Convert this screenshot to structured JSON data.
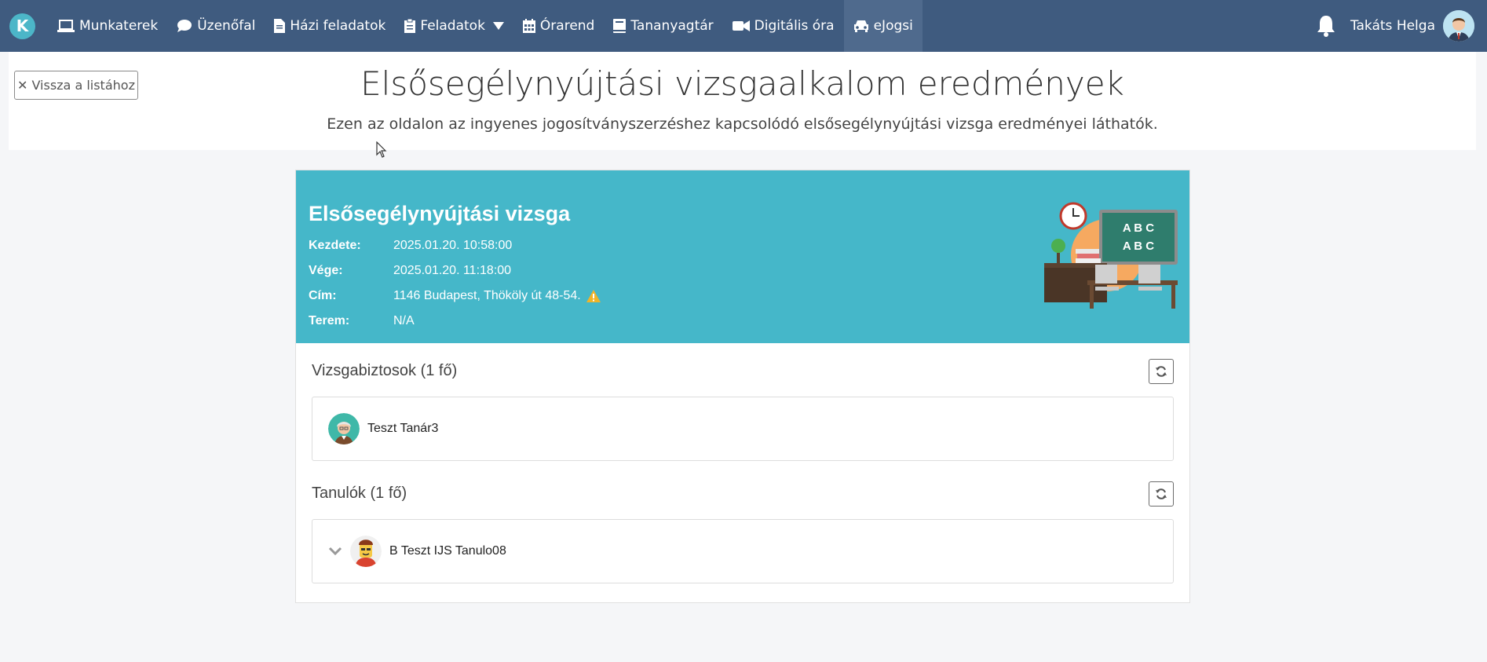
{
  "nav": {
    "brand": "K",
    "items": [
      {
        "label": "Munkaterek",
        "icon": "laptop-icon"
      },
      {
        "label": "Üzenőfal",
        "icon": "comment-icon"
      },
      {
        "label": "Házi feladatok",
        "icon": "file-icon"
      },
      {
        "label": "Feladatok",
        "icon": "clipboard-icon"
      },
      {
        "label": "Órarend",
        "icon": "calendar-icon"
      },
      {
        "label": "Tananyagtár",
        "icon": "book-icon"
      },
      {
        "label": "Digitális óra",
        "icon": "video-camera-icon"
      },
      {
        "label": "eJogsi",
        "icon": "car-icon"
      }
    ],
    "user_name": "Takáts Helga"
  },
  "header": {
    "back_label": "Vissza a listához",
    "title": "Elsősegélynyújtási vizsgaalkalom eredmények",
    "subtitle": "Ezen az oldalon az ingyenes jogosítványszerzéshez kapcsolódó elsősegélynyújtási vizsga eredményei láthatók."
  },
  "exam": {
    "title": "Elsősegélynyújtási vizsga",
    "rows": [
      {
        "label": "Kezdete:",
        "value": "2025.01.20. 10:58:00"
      },
      {
        "label": "Vége:",
        "value": "2025.01.20. 11:18:00"
      },
      {
        "label": "Cím:",
        "value": "1146 Budapest, Thököly út 48-54."
      },
      {
        "label": "Terem:",
        "value": "N/A"
      }
    ],
    "board_text_1": "A B C",
    "board_text_2": "A B C"
  },
  "supervisors": {
    "heading": "Vizsgabiztosok (1 fő)",
    "items": [
      {
        "name": "Teszt Tanár3"
      }
    ]
  },
  "students": {
    "heading": "Tanulók (1 fő)",
    "items": [
      {
        "name": "B Teszt IJS Tanulo08"
      }
    ]
  },
  "colors": {
    "navbar": "#3f5b7f",
    "banner": "#45b7c9",
    "warning": "#f0b429"
  }
}
